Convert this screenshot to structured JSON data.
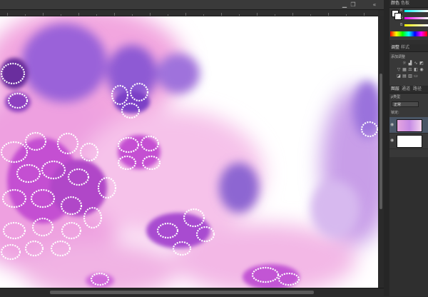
{
  "panels": {
    "color": {
      "tabs": [
        "颜色",
        "色板"
      ],
      "channels": [
        "R",
        "G",
        "B"
      ]
    },
    "adjustments": {
      "tabs": [
        "调整",
        "样式"
      ],
      "title": "添加调整"
    },
    "layers": {
      "tabs": [
        "图层",
        "通道",
        "路径"
      ],
      "filter_label": "ρ类型",
      "blend_mode": "正常",
      "lock_label": "锁定:"
    }
  },
  "icons": [
    "minimize-icon",
    "restore-icon",
    "close-icon",
    "eye-icon",
    "collapse-icon"
  ],
  "colors": {
    "ui_dark": "#2b2b2b",
    "panel": "#383838",
    "canvas": "#ffffff",
    "watercolor_pink": "#e58ad6",
    "watercolor_violet": "#8b5bd8",
    "selected_layer": "#4a5666"
  }
}
